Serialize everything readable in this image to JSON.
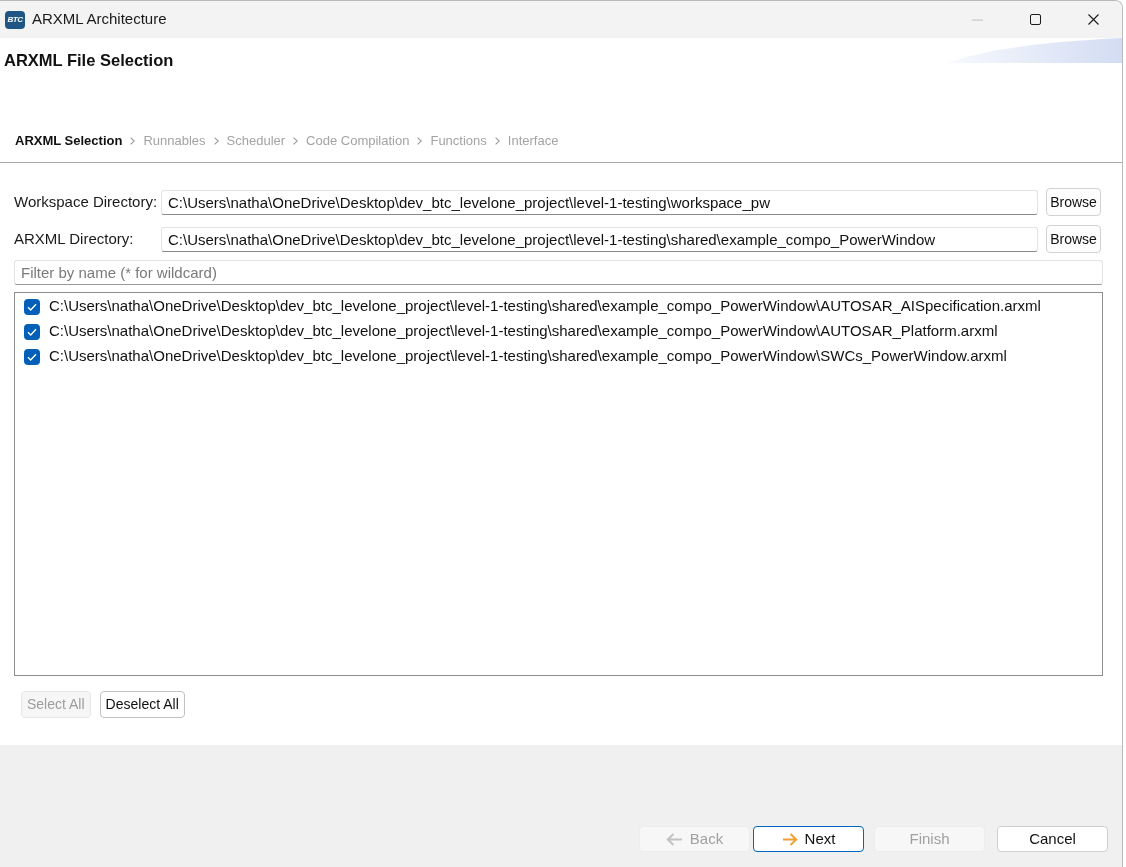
{
  "window": {
    "icon_label": "BTC",
    "title": "ARXML Architecture",
    "controls": [
      {
        "kind": "minimize",
        "disabled": true
      },
      {
        "kind": "maximize",
        "disabled": false
      },
      {
        "kind": "close",
        "disabled": false
      }
    ]
  },
  "page": {
    "title": "ARXML File Selection"
  },
  "steps": [
    {
      "label": "ARXML Selection",
      "selected": true
    },
    {
      "label": "Runnables",
      "selected": false
    },
    {
      "label": "Scheduler",
      "selected": false
    },
    {
      "label": "Code Compilation",
      "selected": false
    },
    {
      "label": "Functions",
      "selected": false
    },
    {
      "label": "Interface",
      "selected": false
    }
  ],
  "directories": [
    {
      "label": "Workspace Directory:",
      "value": "C:\\Users\\natha\\OneDrive\\Desktop\\dev_btc_levelone_project\\level-1-testing\\workspace_pw",
      "button": "Browse"
    },
    {
      "label": "ARXML Directory:",
      "value": "C:\\Users\\natha\\OneDrive\\Desktop\\dev_btc_levelone_project\\level-1-testing\\shared\\example_compo_PowerWindow",
      "button": "Browse"
    }
  ],
  "filter": {
    "placeholder": "Filter by name (* for wildcard)"
  },
  "files": [
    {
      "path": "C:\\Users\\natha\\OneDrive\\Desktop\\dev_btc_levelone_project\\level-1-testing\\shared\\example_compo_PowerWindow\\AUTOSAR_AISpecification.arxml",
      "checked": true
    },
    {
      "path": "C:\\Users\\natha\\OneDrive\\Desktop\\dev_btc_levelone_project\\level-1-testing\\shared\\example_compo_PowerWindow\\AUTOSAR_Platform.arxml",
      "checked": true
    },
    {
      "path": "C:\\Users\\natha\\OneDrive\\Desktop\\dev_btc_levelone_project\\level-1-testing\\shared\\example_compo_PowerWindow\\SWCs_PowerWindow.arxml",
      "checked": true
    }
  ],
  "selection_buttons": [
    {
      "label": "Select All",
      "disabled": true
    },
    {
      "label": "Deselect All",
      "disabled": false
    }
  ],
  "buttons": [
    {
      "kind": "back",
      "label": "Back",
      "disabled": true,
      "default": false
    },
    {
      "kind": "next",
      "label": "Next",
      "disabled": false,
      "default": true
    },
    {
      "kind": "finish",
      "label": "Finish",
      "disabled": true,
      "default": false
    },
    {
      "kind": "cancel",
      "label": "Cancel",
      "disabled": false,
      "default": false
    }
  ]
}
